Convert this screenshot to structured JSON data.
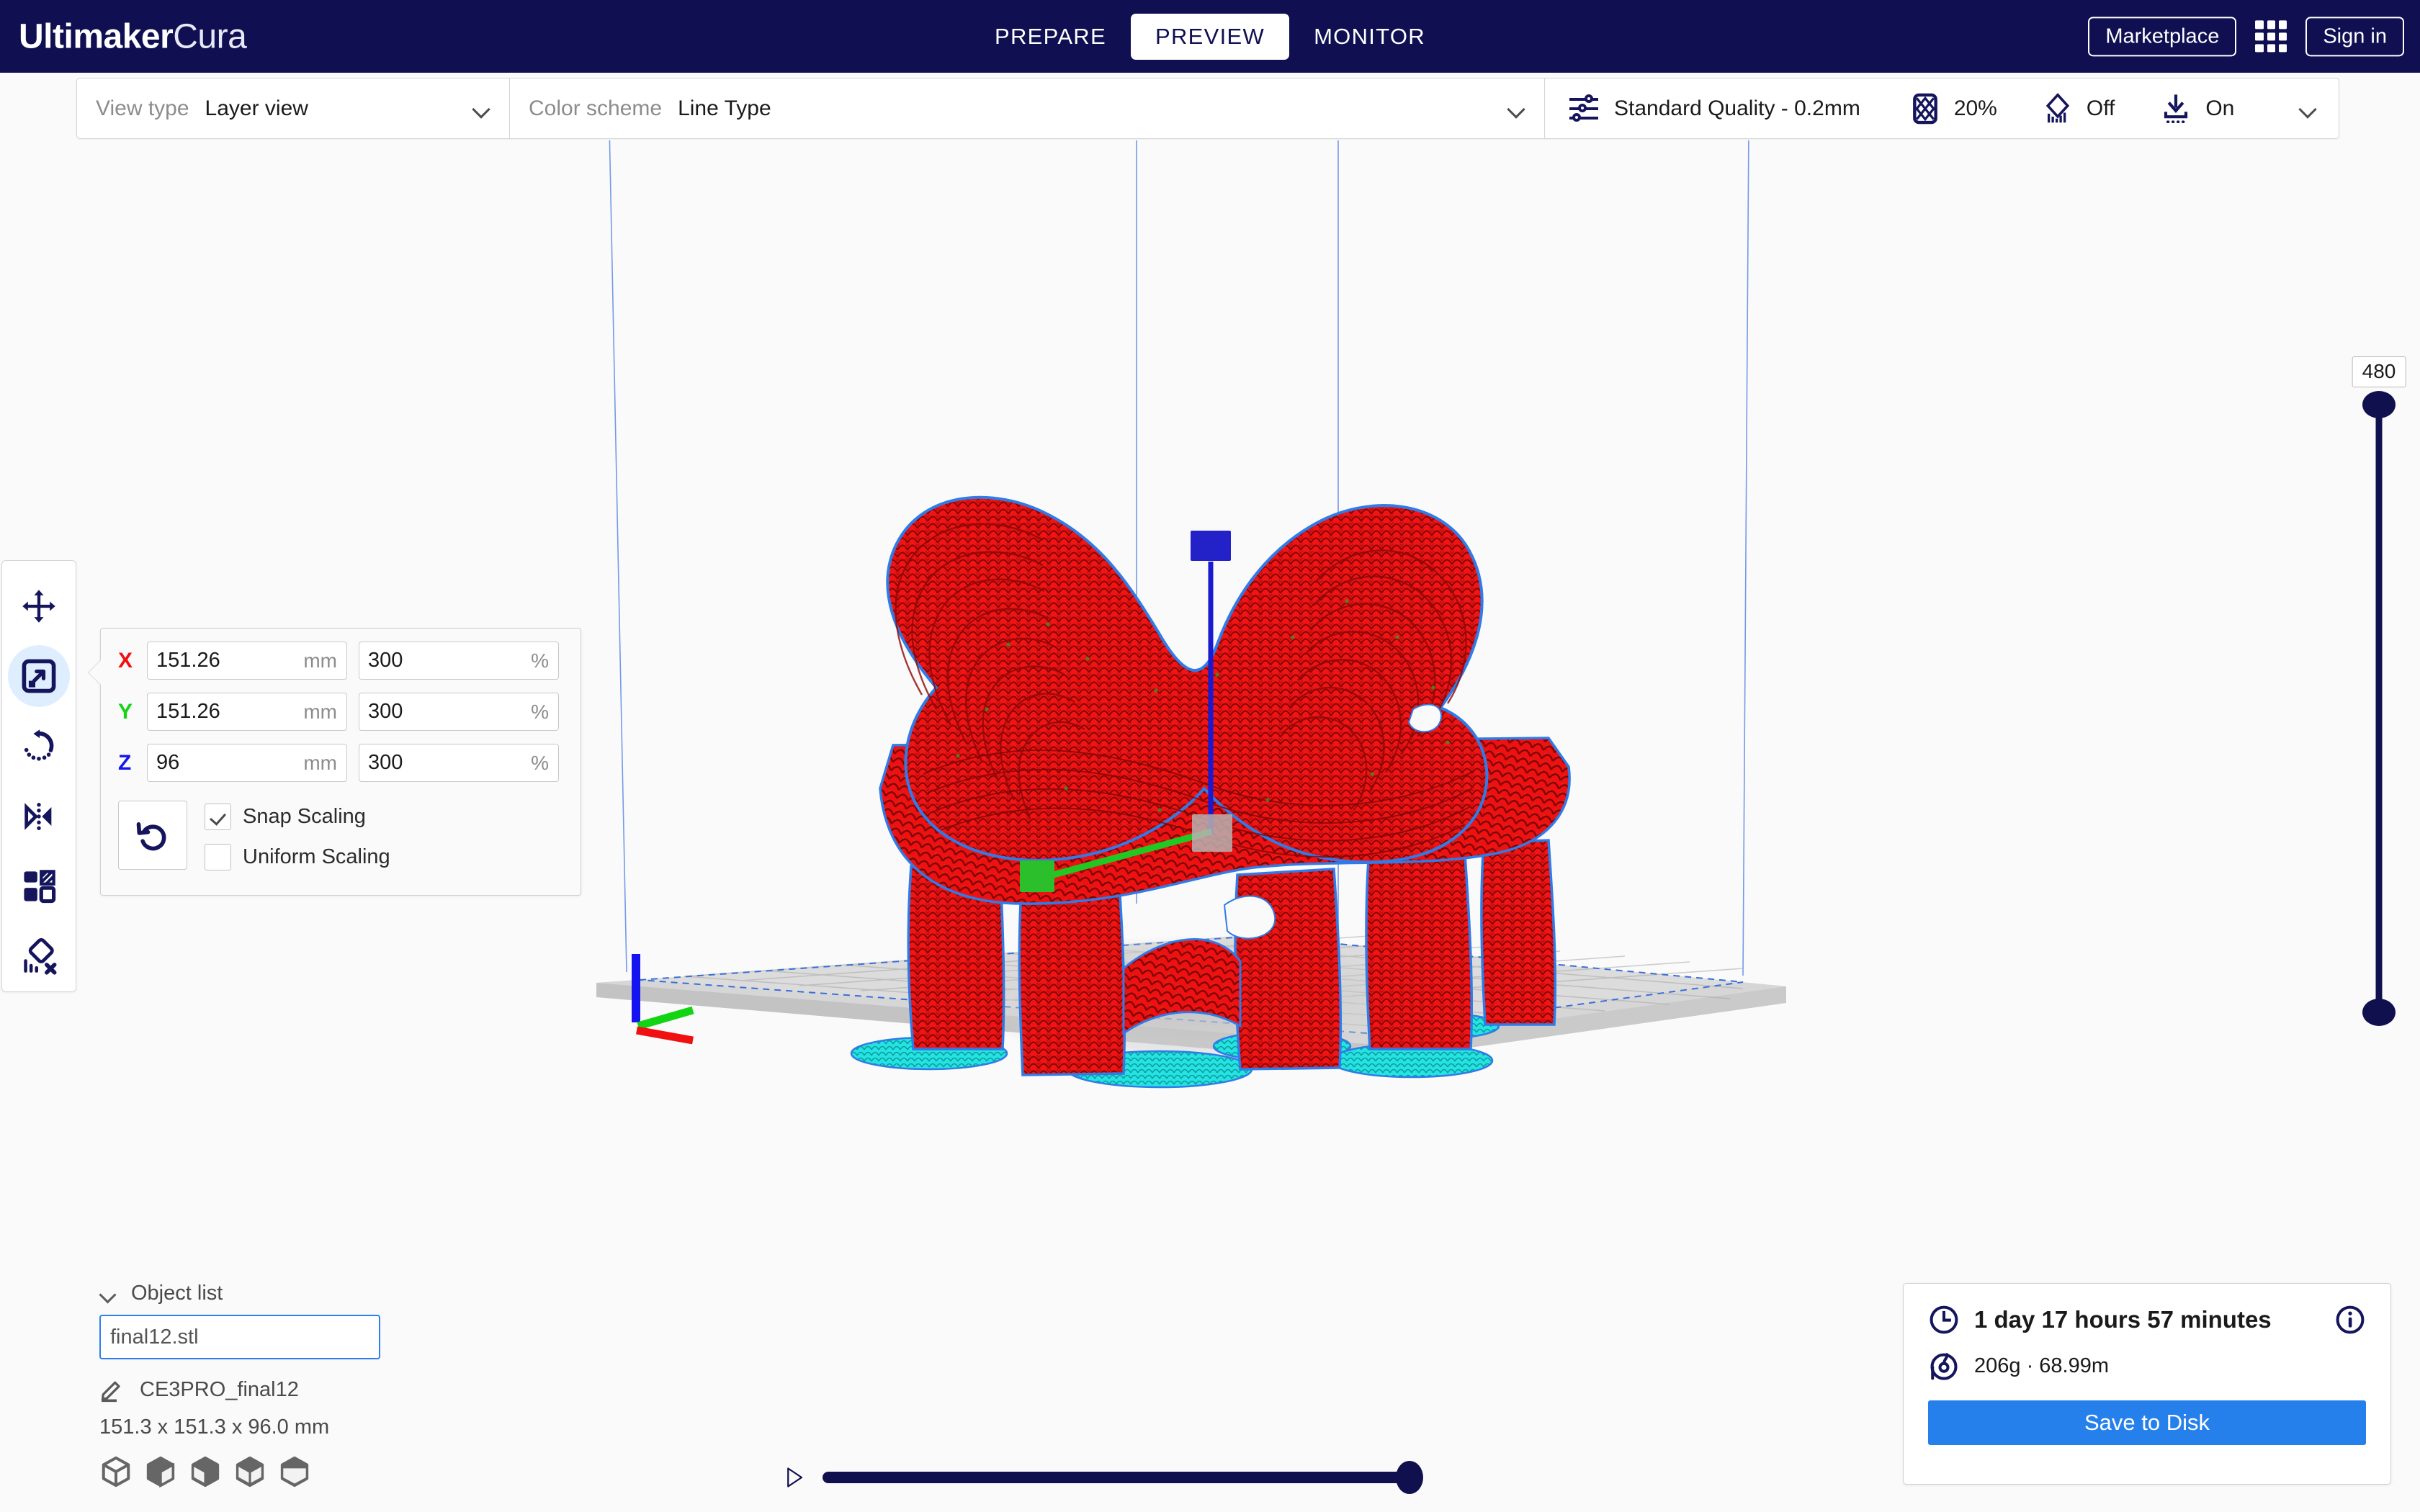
{
  "app": {
    "brand_bold": "Ultimaker",
    "brand_light": "Cura"
  },
  "header": {
    "tabs": [
      {
        "label": "PREPARE",
        "active": false
      },
      {
        "label": "PREVIEW",
        "active": true
      },
      {
        "label": "MONITOR",
        "active": false
      }
    ],
    "marketplace_label": "Marketplace",
    "signin_label": "Sign in",
    "apps_icon": "grid-apps-icon",
    "accent_bg": "#0f0f52"
  },
  "toolbar": {
    "view_type_label": "View type",
    "view_type_value": "Layer view",
    "color_scheme_label": "Color scheme",
    "color_scheme_value": "Line Type",
    "profile_icon": "print-settings-sliders-icon",
    "profile_value": "Standard Quality - 0.2mm",
    "infill_icon": "infill-icon",
    "infill_value": "20%",
    "support_icon": "support-icon",
    "support_value": "Off",
    "adhesion_icon": "adhesion-icon",
    "adhesion_value": "On",
    "expand_icon": "chevron-down-icon"
  },
  "tools": [
    {
      "name": "move-tool",
      "icon": "move-arrows-icon",
      "active": false
    },
    {
      "name": "scale-tool",
      "icon": "scale-icon",
      "active": true
    },
    {
      "name": "rotate-tool",
      "icon": "rotate-icon",
      "active": false
    },
    {
      "name": "mirror-tool",
      "icon": "mirror-icon",
      "active": false
    },
    {
      "name": "per-model-settings-tool",
      "icon": "per-model-settings-icon",
      "active": false
    },
    {
      "name": "support-blocker-tool",
      "icon": "support-blocker-icon",
      "active": false
    }
  ],
  "scale_panel": {
    "rows": [
      {
        "axis": "X",
        "mm": "151.26",
        "unit_mm": "mm",
        "pct": "300",
        "unit_pct": "%"
      },
      {
        "axis": "Y",
        "mm": "151.26",
        "unit_mm": "mm",
        "pct": "300",
        "unit_pct": "%"
      },
      {
        "axis": "Z",
        "mm": "96",
        "unit_mm": "mm",
        "pct": "300",
        "unit_pct": "%"
      }
    ],
    "reset_icon": "reset-scale-icon",
    "snap_scaling_label": "Snap Scaling",
    "snap_scaling_checked": true,
    "uniform_scaling_label": "Uniform Scaling",
    "uniform_scaling_checked": false
  },
  "object_list": {
    "title": "Object list",
    "collapse_icon": "chevron-down-icon",
    "file_name": "final12.stl",
    "edit_icon": "pencil-icon",
    "printer_name": "CE3PRO_final12",
    "dimensions": "151.3 x 151.3 x 96.0 mm",
    "view_modes": [
      "cube-wireframe-icon",
      "cube-solid-icon",
      "cube-front-open-icon",
      "cube-top-open-icon",
      "cube-half-icon"
    ]
  },
  "layer_slider": {
    "value": "480",
    "name": "layer-range-slider"
  },
  "playback": {
    "play_icon": "play-icon",
    "progress_percent": 100
  },
  "print_info": {
    "time_icon": "clock-icon",
    "time_estimate": "1 day 17 hours 57 minutes",
    "info_icon": "info-circle-icon",
    "material_icon": "spool-icon",
    "material_usage": "206g · 68.99m",
    "save_label": "Save to Disk",
    "save_color": "#2680eb"
  },
  "viewport": {
    "name": "build-plate-3d-viewport",
    "model_color_extrusion": "#f51616",
    "model_color_support": "#21e0e0",
    "model_color_outline": "#2b6fe8",
    "build_plate_color": "#d9d9d9",
    "background": "#fafafa"
  }
}
